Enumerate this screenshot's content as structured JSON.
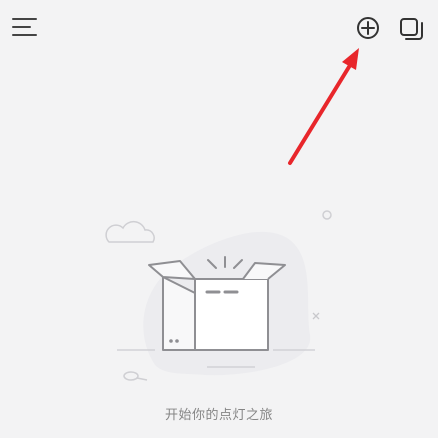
{
  "header": {
    "menu_icon": "menu-icon",
    "add_icon": "add-circle-icon",
    "copy_icon": "copy-icon"
  },
  "annotation": {
    "arrow_color": "#e8262b"
  },
  "empty_state": {
    "illustration": "open-box-illustration",
    "message": "开始你的点灯之旅"
  },
  "colors": {
    "background": "#f3f3f4",
    "icon": "#333333",
    "text": "#858585",
    "accent_arrow": "#e8262b"
  }
}
